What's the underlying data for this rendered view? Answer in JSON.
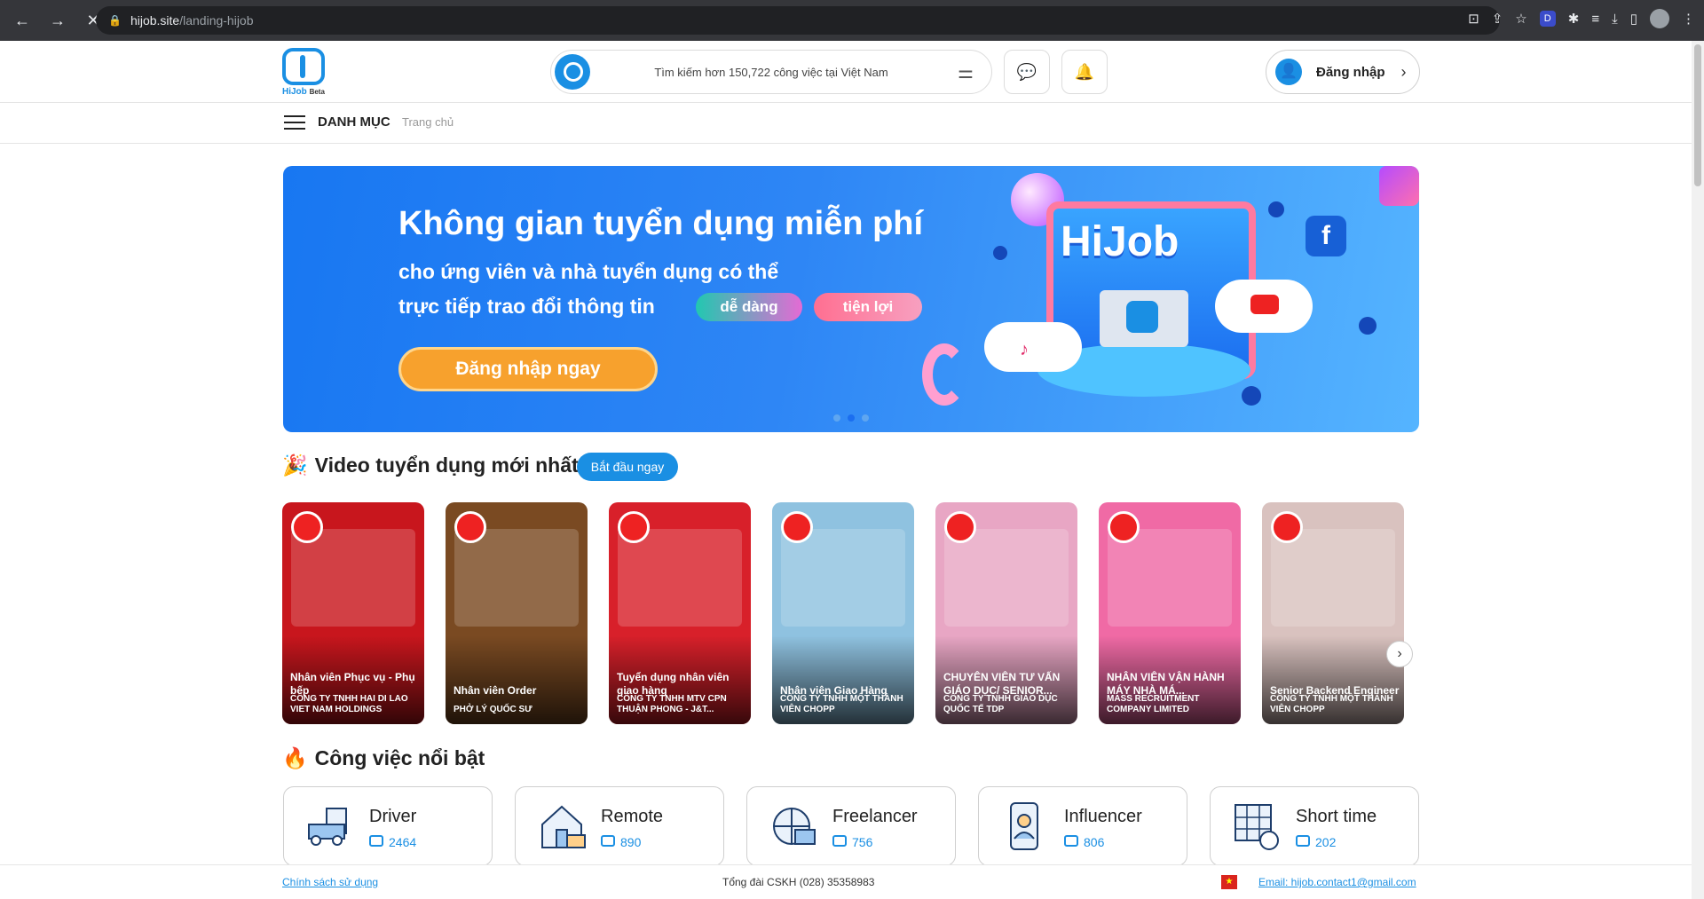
{
  "browser": {
    "url_host": "hijob.site",
    "url_path": "/landing-hijob"
  },
  "header": {
    "logo_name": "HiJob",
    "logo_badge": "Beta",
    "search_placeholder": "Tìm kiếm hơn 150,722 công việc tại Việt Nam",
    "login_label": "Đăng nhập"
  },
  "subnav": {
    "category_label": "DANH MỤC",
    "breadcrumb": "Trang chủ"
  },
  "banner": {
    "title": "Không gian tuyển dụng miễn phí",
    "subtitle_line1": "cho ứng viên và nhà tuyển dụng có thể",
    "subtitle_line2": "trực tiếp trao đổi thông tin",
    "pill_easy": "dễ dàng",
    "pill_convenient": "tiện lợi",
    "cta": "Đăng nhập ngay",
    "brand": "HiJob",
    "slides": 3,
    "active_slide": 2
  },
  "videos": {
    "emoji": "🎉",
    "title": "Video tuyển dụng mới nhất",
    "start_label": "Bắt đầu ngay",
    "items": [
      {
        "title": "Nhân viên Phục vụ - Phụ bếp",
        "company": "CÔNG TY TNHH HAI DI LAO VIET NAM HOLDINGS",
        "bg": "#c8161d"
      },
      {
        "title": "Nhân viên Order",
        "company": "Phở Lý Quốc Sư",
        "bg": "#7a4a22"
      },
      {
        "title": "Tuyển dụng nhân viên giao hàng",
        "company": "Công ty TNHH MTV CPN Thuận Phong - J&T...",
        "bg": "#d8202a"
      },
      {
        "title": "Nhân viên Giao Hàng",
        "company": "CÔNG TY TNHH MỘT THÀNH VIÊN CHOPP",
        "bg": "#8fc2e0"
      },
      {
        "title": "CHUYÊN VIÊN TƯ VẤN GIÁO DỤC/ SENIOR...",
        "company": "CÔNG TY TNHH GIÁO DỤC QUỐC TẾ TDP",
        "bg": "#e8a6c4"
      },
      {
        "title": "NHÂN VIÊN VẬN HÀNH MÁY NHÀ MÁ...",
        "company": "MASS RECRUITMENT COMPANY LIMITED",
        "bg": "#f06aa5"
      },
      {
        "title": "Senior Backend Engineer",
        "company": "CÔNG TY TNHH MỘT THÀNH VIÊN CHOPP",
        "bg": "#d9c2bf"
      }
    ]
  },
  "featured": {
    "emoji": "🔥",
    "title": "Công việc nổi bật",
    "items": [
      {
        "name": "Driver",
        "count": "2464"
      },
      {
        "name": "Remote",
        "count": "890"
      },
      {
        "name": "Freelancer",
        "count": "756"
      },
      {
        "name": "Influencer",
        "count": "806"
      },
      {
        "name": "Short time",
        "count": "202"
      }
    ]
  },
  "footer": {
    "policy": "Chính sách sử dụng",
    "hotline": "Tổng đài CSKH  (028) 35358983",
    "email": "Email: hijob.contact1@gmail.com"
  },
  "colors": {
    "primary": "#1a8fe3",
    "cta": "#f7a12d"
  }
}
